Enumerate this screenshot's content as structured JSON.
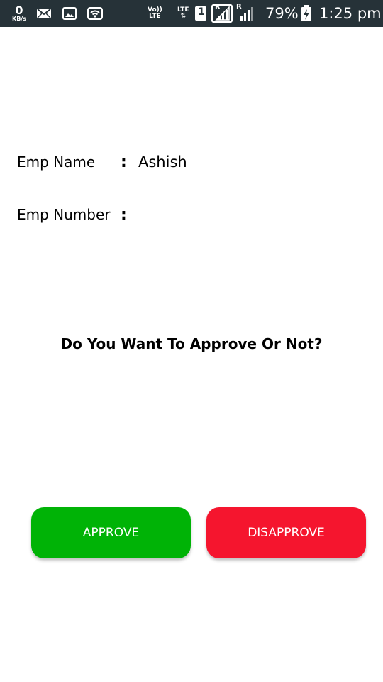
{
  "status_bar": {
    "speed_value": "0",
    "speed_unit": "KB/s",
    "volte_top": "Vo))",
    "volte_bottom": "LTE",
    "lte_label": "LTE",
    "sim_number": "1",
    "roaming_letter": "R",
    "battery": "79%",
    "time": "1:25 pm",
    "background": "#263238",
    "icons": [
      "speed-indicator",
      "mail-icon",
      "image-icon",
      "wifi-icon",
      "volte-icon",
      "lte-icon",
      "signal-icon",
      "battery-charging-icon"
    ]
  },
  "employee": {
    "name_label": "Emp Name",
    "name_colon": ":",
    "name_value": "Ashish",
    "number_label": "Emp Number",
    "number_colon": ":",
    "number_value": ""
  },
  "question": "Do You Want To Approve Or Not?",
  "buttons": {
    "approve_label": "APPROVE",
    "approve_color": "#00b306",
    "disapprove_label": "DISAPPROVE",
    "disapprove_color": "#f5152e"
  }
}
